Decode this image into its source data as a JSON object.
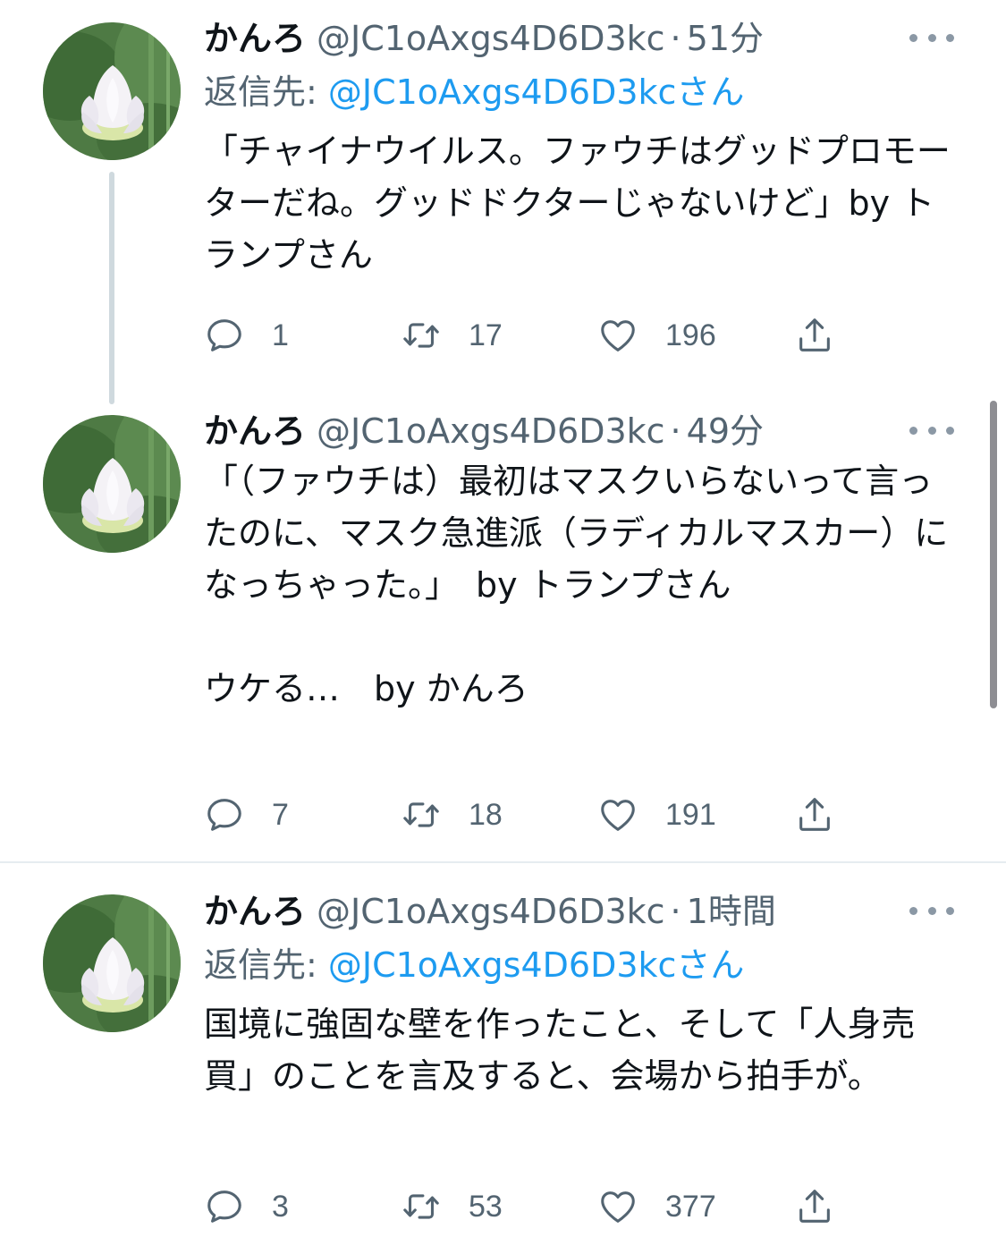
{
  "colors": {
    "accent": "#1d9bf0",
    "secondary_text": "#536471",
    "thread_line": "#cfd9de"
  },
  "tweets": [
    {
      "author_name": "かんろ",
      "handle": "@JC1oAxgs4D6D3kc",
      "separator": "·",
      "time": "51分",
      "reply_prefix": "返信先: ",
      "reply_mention": "@JC1oAxgs4D6D3kcさん",
      "text": "「チャイナウイルス。ファウチはグッドプロモーターだね。グッドドクターじゃないけど」by トランプさん",
      "replies": "1",
      "retweets": "17",
      "likes": "196"
    },
    {
      "author_name": "かんろ",
      "handle": "@JC1oAxgs4D6D3kc",
      "separator": "·",
      "time": "49分",
      "text": "「（ファウチは）最初はマスクいらないって言ったのに、マスク急進派（ラディカルマスカー）になっちゃった。」　by トランプさん\n\nウケる…　by かんろ",
      "replies": "7",
      "retweets": "18",
      "likes": "191"
    },
    {
      "author_name": "かんろ",
      "handle": "@JC1oAxgs4D6D3kc",
      "separator": "·",
      "time": "1時間",
      "reply_prefix": "返信先: ",
      "reply_mention": "@JC1oAxgs4D6D3kcさん",
      "text": "国境に強固な壁を作ったこと、そして「人身売買」のことを言及すると、会場から拍手が。",
      "replies": "3",
      "retweets": "53",
      "likes": "377"
    }
  ],
  "icons": {
    "reply": "reply-icon",
    "retweet": "retweet-icon",
    "like": "heart-icon",
    "share": "share-icon",
    "more": "more-icon"
  }
}
